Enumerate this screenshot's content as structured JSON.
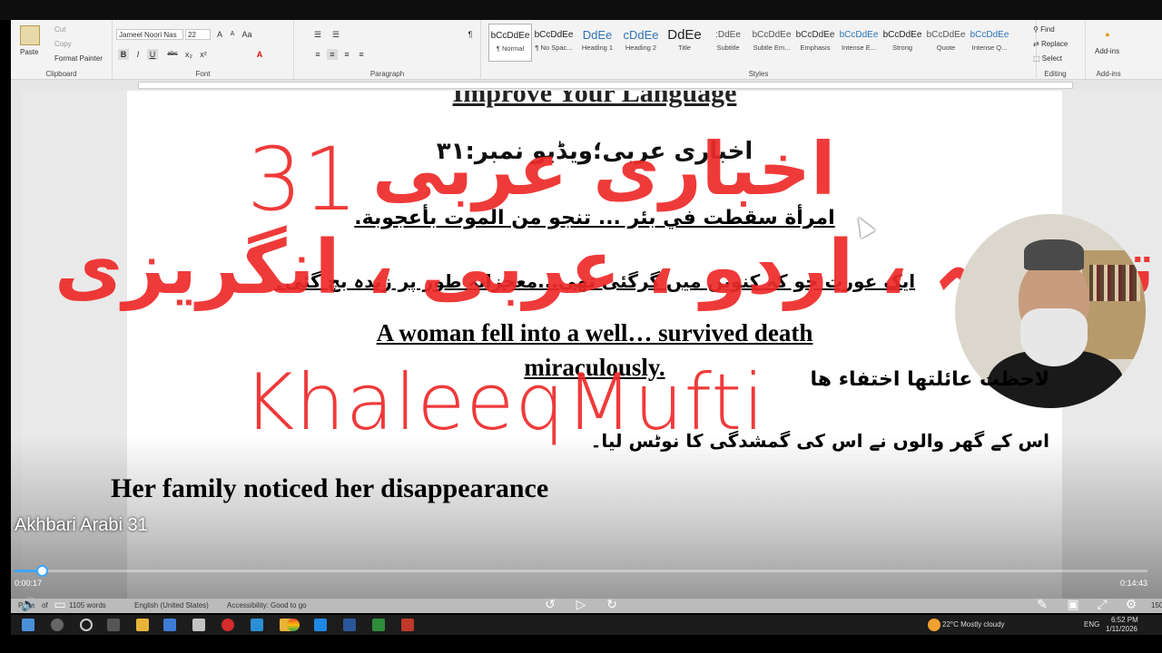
{
  "ribbon": {
    "clipboard": {
      "paste": "Paste",
      "cut": "Cut",
      "copy": "Copy",
      "format_painter": "Format Painter",
      "label": "Clipboard"
    },
    "font": {
      "family": "Jameel Noori Nas",
      "size": "22",
      "label": "Font",
      "bold": "B",
      "italic": "I",
      "underline": "U",
      "strike": "abc",
      "sub": "x₂",
      "sup": "x²",
      "grow": "A",
      "shrink": "A",
      "case": "Aa",
      "color": "A"
    },
    "paragraph": {
      "label": "Paragraph",
      "pilcrow": "¶"
    },
    "styles": {
      "label": "Styles",
      "items": [
        {
          "preview": "bCcDdEe",
          "name": "¶ Normal"
        },
        {
          "preview": "bCcDdEe",
          "name": "¶ No Spac..."
        },
        {
          "preview": "DdEe",
          "name": "Heading 1"
        },
        {
          "preview": "cDdEe",
          "name": "Heading 2"
        },
        {
          "preview": "DdEe",
          "name": "Title"
        },
        {
          "preview": ":DdEe",
          "name": "Subtitle"
        },
        {
          "preview": "bCcDdEe",
          "name": "Subtle Em..."
        },
        {
          "preview": "bCcDdEe",
          "name": "Emphasis"
        },
        {
          "preview": "bCcDdEe",
          "name": "Intense E..."
        },
        {
          "preview": "bCcDdEe",
          "name": "Strong"
        },
        {
          "preview": "bCcDdEe",
          "name": "Quote"
        },
        {
          "preview": "bCcDdEe",
          "name": "Intense Q..."
        }
      ]
    },
    "editing": {
      "find": "Find",
      "replace": "Replace",
      "select": "Select",
      "label": "Editing"
    },
    "addins": {
      "label": "Add-ins",
      "button": "Add-ins"
    }
  },
  "document": {
    "heading_top": "Improve Your Language",
    "urdu_title": "اخباری عربی؛ویڈیو نمبر:۳۱",
    "arabic_1": "امرأة سقطت في بئر ... تنجو من الموت بأعجوبة.",
    "urdu_1": "ایک عورت جو کہ کنویں میں گرگئی تھی...معجزانہ طور پر زندہ بچ گئی۔",
    "english_1": "A woman fell into a well… survived death miraculously.",
    "arabic_2": "لاحظت عائلتها اختفاء ها",
    "urdu_2": "اس کے گھر والوں نے اس کی گمشدگی کا نوٹس لیا۔",
    "english_2": "Her family noticed her disappearance"
  },
  "watermark": {
    "number": "31",
    "akhbari": "اخباری عربی",
    "tarjama": "ترجمہ ، اردو ، عربی ، انگریزی",
    "name": "KhaleeqMufti"
  },
  "video": {
    "title": "Akhbari Arabi 31",
    "current_time": "0:00:17",
    "duration": "0:14:43",
    "progress_fraction": 0.024
  },
  "statusbar": {
    "page": "Page",
    "of": "of",
    "words": "1105 words",
    "language": "English (United States)",
    "accessibility": "Accessibility: Good to go",
    "zoom": "150"
  },
  "taskbar": {
    "weather": "22°C  Mostly cloudy",
    "lang": "ENG",
    "time": "6:52 PM",
    "date": "1/11/2026"
  }
}
